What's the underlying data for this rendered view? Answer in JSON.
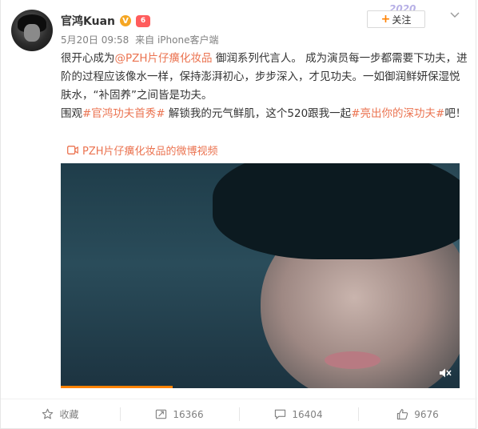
{
  "header": {
    "username": "官鸿Kuan",
    "verified_badge": "V",
    "vip_badge": "6",
    "date": "5月20日 09:58",
    "source": "来自 iPhone客户端",
    "decoration_text": "2020",
    "follow_label": "关注"
  },
  "post": {
    "line1_prefix": "很开心成为",
    "mention": "@PZH片仔癀化妆品",
    "line1_suffix": " 御润系列代言人。 成为演员每一步都需要下功夫，进阶的过程应该像水一样，保持澎湃初心，步步深入，才见功夫。一如御润鲜妍保湿悦肤水，“补固养”之间皆是功夫。",
    "line2_prefix": "围观",
    "hashtag1": "#官鸿功夫首秀#",
    "line2_middle": " 解锁我的元气鲜肌，这个520跟我一起",
    "hashtag2": "#亮出你的深功夫#",
    "line2_suffix": "吧！",
    "video_link": "PZH片仔癀化妆品的微博视频"
  },
  "actions": {
    "favorite_label": "收藏",
    "repost_count": "16366",
    "comment_count": "16404",
    "like_count": "9676"
  },
  "colors": {
    "link": "#eb7350",
    "accent": "#ff8200"
  },
  "icons": [
    "star-icon",
    "repost-icon",
    "comment-icon",
    "like-icon",
    "mute-icon",
    "video-icon",
    "chevron-down-icon"
  ]
}
